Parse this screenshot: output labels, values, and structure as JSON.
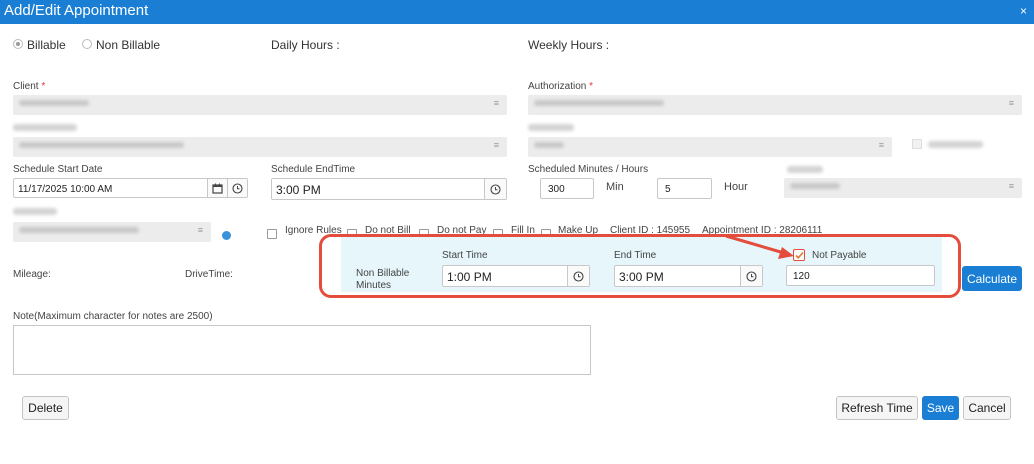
{
  "titlebar": {
    "title": "Add/Edit Appointment",
    "close": "×"
  },
  "billing": {
    "billable_label": "Billable",
    "non_billable_label": "Non Billable"
  },
  "daily_hours_label": "Daily Hours :",
  "weekly_hours_label": "Weekly Hours :",
  "client": {
    "label": "Client",
    "required": "*"
  },
  "authorization": {
    "label": "Authorization",
    "required": "*"
  },
  "schedule_start": {
    "label": "Schedule Start Date",
    "value": "11/17/2025 10:00 AM"
  },
  "schedule_end": {
    "label": "Schedule EndTime",
    "value": "3:00 PM"
  },
  "scheduled_minutes": {
    "label": "Scheduled Minutes / Hours",
    "minutes": "300",
    "min_label": "Min",
    "hours": "5",
    "hour_label": "Hour"
  },
  "checkboxes": {
    "ignore_rules": "Ignore Rules",
    "do_not_bill": "Do not Bill",
    "do_not_pay": "Do not Pay",
    "fill_in": "Fill In",
    "make_up": "Make Up"
  },
  "client_id": "Client ID : 145955",
  "appointment_id": "Appointment ID : 28206111",
  "mileage_label": "Mileage:",
  "drive_time_label": "DriveTime:",
  "non_billable": {
    "label": "Non Billable Minutes",
    "start_time_label": "Start Time",
    "start_time_value": "1:00 PM",
    "end_time_label": "End Time",
    "end_time_value": "3:00 PM",
    "not_payable_label": "Not Payable",
    "not_payable_checked": true,
    "minutes_value": "120"
  },
  "calculate_label": "Calculate",
  "note_label": "Note(Maximum character for notes are 2500)",
  "buttons": {
    "delete": "Delete",
    "refresh": "Refresh Time",
    "save": "Save",
    "cancel": "Cancel"
  },
  "icons": {
    "calendar": "calendar-icon",
    "clock": "clock-icon",
    "dropdown": "dropdown-icon",
    "arrow": "annotation-arrow"
  },
  "colors": {
    "accent": "#1a7fd4",
    "highlight": "#e44c3b",
    "panel_bg": "#e6f6fb",
    "required": "#e53935"
  }
}
